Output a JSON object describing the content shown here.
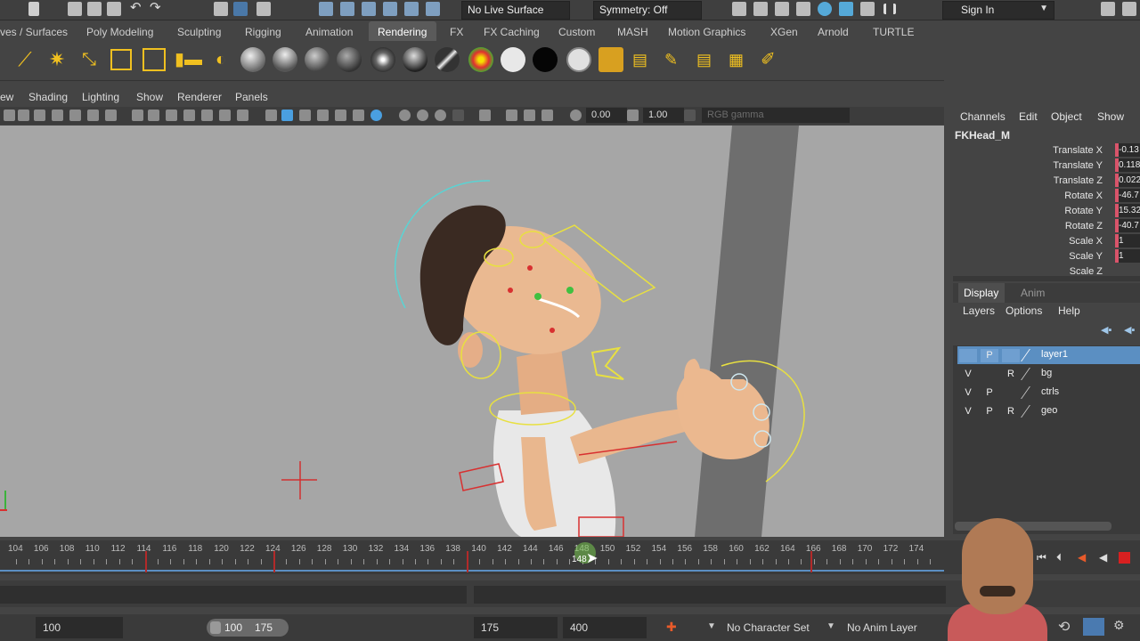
{
  "statusline": {
    "live_surface": "No Live Surface",
    "symmetry": "Symmetry: Off",
    "sign_in": "Sign In"
  },
  "shelf_tabs": [
    "ves / Surfaces",
    "Poly Modeling",
    "Sculpting",
    "Rigging",
    "Animation",
    "Rendering",
    "FX",
    "FX Caching",
    "Custom",
    "MASH",
    "Motion Graphics",
    "XGen",
    "Arnold",
    "TURTLE"
  ],
  "active_tab": "Rendering",
  "viewport_menu": [
    "ew",
    "Shading",
    "Lighting",
    "Show",
    "Renderer",
    "Panels"
  ],
  "viewport_toolbar": {
    "exposure": "0.00",
    "gamma": "1.00",
    "color_space": "RGB gamma"
  },
  "channel_box": {
    "menu": [
      "Channels",
      "Edit",
      "Object",
      "Show"
    ],
    "object_name": "FKHead_M",
    "attributes": [
      {
        "label": "Translate X",
        "value": "-0.13"
      },
      {
        "label": "Translate Y",
        "value": "0.118"
      },
      {
        "label": "Translate Z",
        "value": "0.022"
      },
      {
        "label": "Rotate X",
        "value": "-46.7"
      },
      {
        "label": "Rotate Y",
        "value": "15.32"
      },
      {
        "label": "Rotate Z",
        "value": "-40.7"
      },
      {
        "label": "Scale X",
        "value": "1"
      },
      {
        "label": "Scale Y",
        "value": "1"
      },
      {
        "label": "Scale Z",
        "value": ""
      }
    ]
  },
  "layer_editor": {
    "tabs": [
      "Display",
      "Anim"
    ],
    "menu": [
      "Layers",
      "Options",
      "Help"
    ],
    "layers": [
      {
        "v": "",
        "p": "P",
        "r": "",
        "name": "layer1",
        "selected": true
      },
      {
        "v": "V",
        "p": "",
        "r": "R",
        "name": "bg",
        "selected": false
      },
      {
        "v": "V",
        "p": "P",
        "r": "",
        "name": "ctrls",
        "selected": false
      },
      {
        "v": "V",
        "p": "P",
        "r": "R",
        "name": "geo",
        "selected": false
      }
    ]
  },
  "time_slider": {
    "labels": [
      "104",
      "106",
      "108",
      "110",
      "112",
      "114",
      "116",
      "118",
      "120",
      "122",
      "124",
      "126",
      "128",
      "130",
      "132",
      "134",
      "136",
      "138",
      "140",
      "142",
      "144",
      "146",
      "148",
      "150",
      "152",
      "154",
      "156",
      "158",
      "160",
      "162",
      "164",
      "166",
      "168",
      "170",
      "172",
      "174"
    ],
    "current_frame": "148"
  },
  "range": {
    "start": "100",
    "range_start": "100",
    "range_end": "175",
    "end": "175",
    "anim_end": "400",
    "character_set": "No Character Set",
    "anim_layer": "No Anim Layer"
  },
  "colors": {
    "accent": "#4a8fd0",
    "key": "#b22a2a",
    "viewport_bg": "#a6a6a6"
  }
}
